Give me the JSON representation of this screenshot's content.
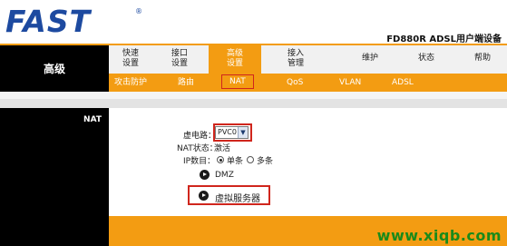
{
  "header": {
    "logo": "FAST",
    "reg_mark": "®",
    "model": "FD880R ADSL用户端设备"
  },
  "section_title": "高级",
  "top_tabs": [
    {
      "l1": "快速",
      "l2": "设置"
    },
    {
      "l1": "接口",
      "l2": "设置"
    },
    {
      "l1": "高级",
      "l2": "设置"
    },
    {
      "l1": "接入",
      "l2": "管理"
    },
    {
      "l1": "维护",
      "l2": ""
    },
    {
      "l1": "状态",
      "l2": ""
    },
    {
      "l1": "帮助",
      "l2": ""
    }
  ],
  "sub_tabs": [
    "攻击防护",
    "路由",
    "NAT",
    "QoS",
    "VLAN",
    "ADSL"
  ],
  "page_section": "NAT",
  "form": {
    "vc_label": "虚电路：",
    "vc_value": "PVC0",
    "nat_status_label": "NAT状态：",
    "nat_status_value": "激活",
    "ip_count_label": "IP数目：",
    "ip_single": "单条",
    "ip_multi": "多条",
    "dmz_link": "DMZ",
    "virtual_server_link": "虚拟服务器"
  },
  "watermark": "www.xiqb.com",
  "colors": {
    "accent": "#f39c12",
    "brand": "#1d4aa0",
    "highlight_border": "#d0261d"
  }
}
